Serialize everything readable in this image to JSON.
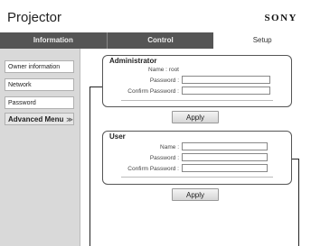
{
  "header": {
    "title": "Projector",
    "brand": "SONY"
  },
  "tabs": [
    {
      "label": "Information"
    },
    {
      "label": "Control"
    },
    {
      "label": "Setup"
    }
  ],
  "sidebar": {
    "items": [
      {
        "label": "Owner information"
      },
      {
        "label": "Network"
      },
      {
        "label": "Password"
      }
    ],
    "advanced_menu": {
      "label": "Advanced Menu",
      "chevron": "≫"
    }
  },
  "administrator": {
    "title": "Administrator",
    "name_label": "Name : root",
    "password_label": "Password :",
    "password_value": "",
    "confirm_label": "Confirm Password :",
    "confirm_value": "",
    "apply_label": "Apply"
  },
  "user": {
    "title": "User",
    "name_label": "Name :",
    "name_value": "",
    "password_label": "Password :",
    "password_value": "",
    "confirm_label": "Confirm Password :",
    "confirm_value": "",
    "apply_label": "Apply"
  }
}
